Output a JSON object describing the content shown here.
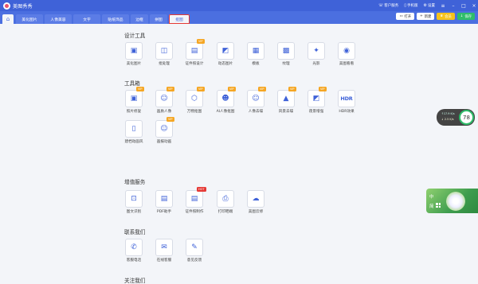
{
  "titlebar": {
    "app_name": "美图秀秀",
    "customer_service": "客户服务",
    "phone_version": "手机版",
    "settings": "设置"
  },
  "tabs": [
    {
      "label": "美化图片"
    },
    {
      "label": "人像美容"
    },
    {
      "label": "文字"
    },
    {
      "label": "贴纸饰品"
    },
    {
      "label": "边框"
    },
    {
      "label": "拼图"
    },
    {
      "label": "抠图"
    }
  ],
  "active_tab_index": 6,
  "actions": {
    "open": "打开",
    "new": "新建",
    "vip": "会员",
    "save": "保存"
  },
  "sections": {
    "design": {
      "title": "设计工具",
      "tools": [
        {
          "label": "美化图片",
          "icon": "image-icon",
          "badge": ""
        },
        {
          "label": "批处理",
          "icon": "layers-icon",
          "badge": ""
        },
        {
          "label": "证件照设计",
          "icon": "id-card-icon",
          "badge": "VIP"
        },
        {
          "label": "动态图片",
          "icon": "motion-image-icon",
          "badge": ""
        },
        {
          "label": "模板",
          "icon": "grid-icon",
          "badge": ""
        },
        {
          "label": "纹理",
          "icon": "texture-icon",
          "badge": ""
        },
        {
          "label": "光影",
          "icon": "sparkle-icon",
          "badge": ""
        },
        {
          "label": "美图看看",
          "icon": "viewer-icon",
          "badge": ""
        }
      ]
    },
    "toolbox": {
      "title": "工具箱",
      "tools": [
        {
          "label": "照片修复",
          "icon": "photo-repair-icon",
          "badge": "VIP"
        },
        {
          "label": "画质人像",
          "icon": "portrait-icon",
          "badge": "VIP"
        },
        {
          "label": "万物抠图",
          "icon": "cutout-icon",
          "badge": "VIP"
        },
        {
          "label": "AI人像抠图",
          "icon": "ai-portrait-icon",
          "badge": "VIP"
        },
        {
          "label": "人像去噪",
          "icon": "portrait-denoise-icon",
          "badge": "VIP"
        },
        {
          "label": "风景去噪",
          "icon": "landscape-denoise-icon",
          "badge": "VIP"
        },
        {
          "label": "夜景增强",
          "icon": "night-enhance-icon",
          "badge": "VIP"
        },
        {
          "label": "HDR效果",
          "icon": "hdr-icon",
          "badge": ""
        },
        {
          "label": "建档动画风",
          "icon": "phone-icon",
          "badge": ""
        },
        {
          "label": "画报动画",
          "icon": "poster-icon",
          "badge": "VIP"
        }
      ]
    },
    "services": {
      "title": "增值服务",
      "tools": [
        {
          "label": "图文识别",
          "icon": "ocr-icon",
          "badge": ""
        },
        {
          "label": "PDF助手",
          "icon": "pdf-icon",
          "badge": ""
        },
        {
          "label": "证件照制作",
          "icon": "id-photo-icon",
          "badge": "HOT"
        },
        {
          "label": "打印晒端",
          "icon": "printer-icon",
          "badge": ""
        },
        {
          "label": "美图云修",
          "icon": "cloud-icon",
          "badge": ""
        }
      ]
    },
    "contact": {
      "title": "联系我们",
      "tools": [
        {
          "label": "客服电话",
          "icon": "phone-call-icon",
          "badge": ""
        },
        {
          "label": "在线客服",
          "icon": "chat-icon",
          "badge": ""
        },
        {
          "label": "意见反馈",
          "icon": "feedback-icon",
          "badge": ""
        }
      ]
    },
    "follow": {
      "title": "关注我们"
    }
  },
  "weather": {
    "line1": "↑17.9 K/s",
    "line2": "↓ 2.5 K/s",
    "value": "78"
  },
  "widget": {
    "line1": "中",
    "line2": "简"
  },
  "colors": {
    "brand_blue": "#3f62d8",
    "vip_badge": "#f5a623",
    "hot_badge": "#e53935",
    "save_green": "#2fbd6a",
    "vip_gold": "#f5c21b"
  }
}
